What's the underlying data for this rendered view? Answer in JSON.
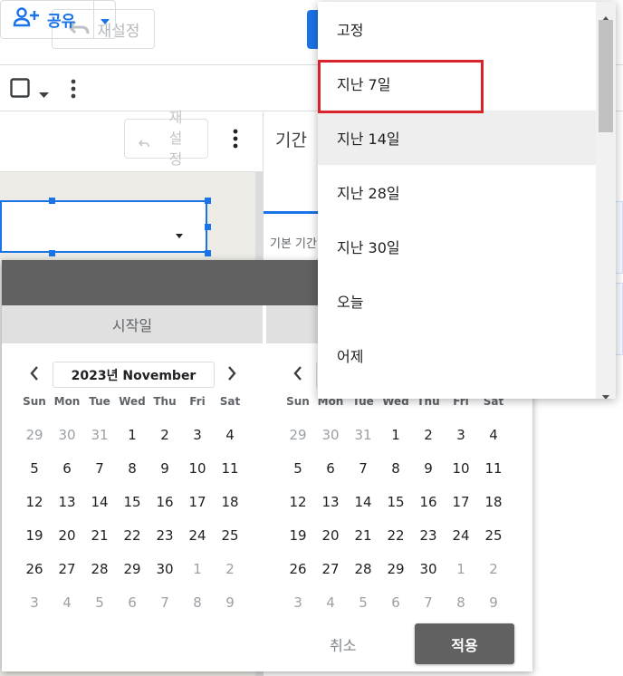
{
  "topbar": {
    "reset_label": "재설정",
    "share_label": "공유"
  },
  "canvas": {
    "reset_label": "재\n설\n정"
  },
  "panel": {
    "title": "기간",
    "label": "기본 기간"
  },
  "datepicker": {
    "start_label": "시작일",
    "end_label": "",
    "weekdays": [
      "Sun",
      "Mon",
      "Tue",
      "Wed",
      "Thu",
      "Fri",
      "Sat"
    ],
    "left_month": "2023년 November",
    "right_month": "",
    "weeks": [
      [
        [
          "29",
          1
        ],
        [
          "30",
          1
        ],
        [
          "31",
          1
        ],
        [
          "1",
          0
        ],
        [
          "2",
          0
        ],
        [
          "3",
          0
        ],
        [
          "4",
          0
        ]
      ],
      [
        [
          "5",
          0
        ],
        [
          "6",
          0
        ],
        [
          "7",
          0
        ],
        [
          "8",
          0
        ],
        [
          "9",
          0
        ],
        [
          "10",
          0
        ],
        [
          "11",
          0
        ]
      ],
      [
        [
          "12",
          0
        ],
        [
          "13",
          0
        ],
        [
          "14",
          0
        ],
        [
          "15",
          0
        ],
        [
          "16",
          0
        ],
        [
          "17",
          0
        ],
        [
          "18",
          0
        ]
      ],
      [
        [
          "19",
          0
        ],
        [
          "20",
          0
        ],
        [
          "21",
          0
        ],
        [
          "22",
          0
        ],
        [
          "23",
          0
        ],
        [
          "24",
          0
        ],
        [
          "25",
          0
        ]
      ],
      [
        [
          "26",
          0
        ],
        [
          "27",
          0
        ],
        [
          "28",
          0
        ],
        [
          "29",
          0
        ],
        [
          "30",
          0
        ],
        [
          "1",
          1
        ],
        [
          "2",
          1
        ]
      ],
      [
        [
          "3",
          1
        ],
        [
          "4",
          1
        ],
        [
          "5",
          1
        ],
        [
          "6",
          1
        ],
        [
          "7",
          1
        ],
        [
          "8",
          1
        ],
        [
          "9",
          1
        ]
      ]
    ],
    "cancel_label": "취소",
    "apply_label": "적용"
  },
  "menu": {
    "items": [
      "고정",
      "지난 7일",
      "지난 14일",
      "지난 28일",
      "지난 30일",
      "오늘",
      "어제"
    ],
    "hover_index": 2,
    "highlight_index": 1
  },
  "colors": {
    "accent": "#1a73e8",
    "highlight": "#d8232a",
    "header_gray": "#616161"
  }
}
